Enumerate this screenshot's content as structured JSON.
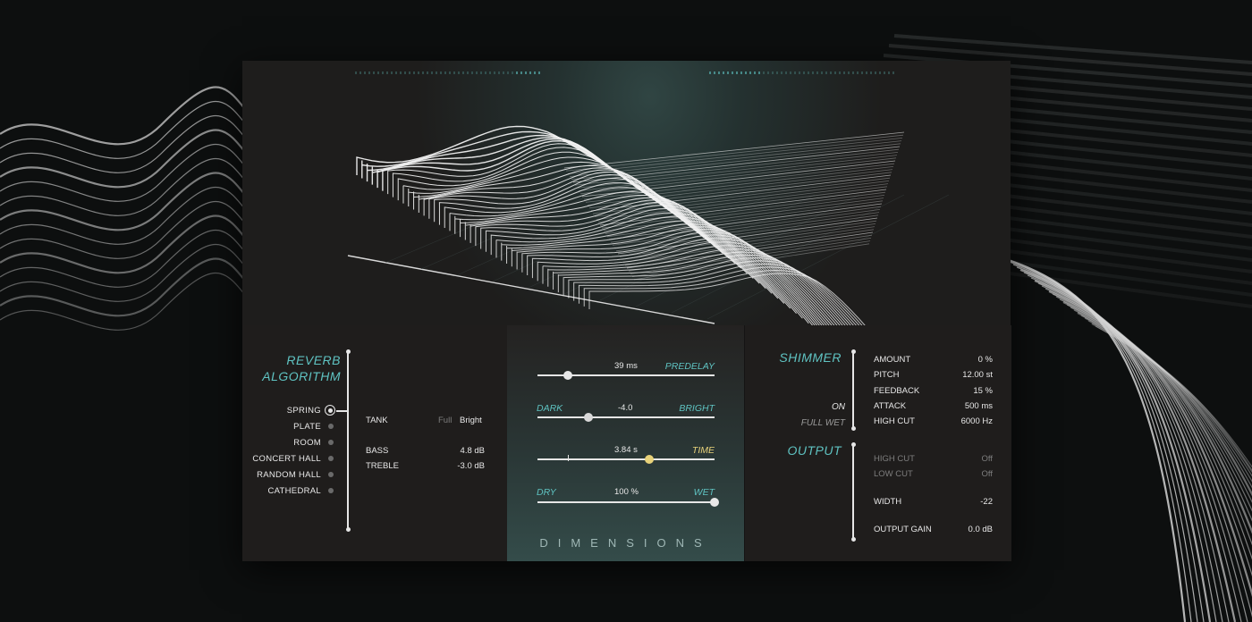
{
  "reverb": {
    "title_line1": "REVERB",
    "title_line2": "ALGORITHM",
    "algorithms": [
      "SPRING",
      "PLATE",
      "ROOM",
      "CONCERT HALL",
      "RANDOM HALL",
      "CATHEDRAL"
    ],
    "selected": "SPRING",
    "tank_label": "TANK",
    "tank_options": [
      "Full",
      "Bright"
    ],
    "tank_selected": "Bright",
    "bass_label": "BASS",
    "bass_value": "4.8 dB",
    "treble_label": "TREBLE",
    "treble_value": "-3.0 dB"
  },
  "center": {
    "predelay_value": "39 ms",
    "predelay_label": "PREDELAY",
    "predelay_level": 0.17,
    "tone_left": "DARK",
    "tone_value": "-4.0",
    "tone_right": "BRIGHT",
    "tone_level": 0.29,
    "time_value": "3.84 s",
    "time_label": "TIME",
    "time_level": 0.63,
    "mix_left": "DRY",
    "mix_value": "100 %",
    "mix_right": "WET",
    "mix_level": 1.0,
    "brand": "DIMENSIONS",
    "time_color": "#e8d27a",
    "accent": "#5fc3c2"
  },
  "shimmer": {
    "title": "SHIMMER",
    "on_label": "ON",
    "fullwet_label": "FULL WET",
    "params": [
      {
        "label": "AMOUNT",
        "value": "0 %"
      },
      {
        "label": "PITCH",
        "value": "12.00 st"
      },
      {
        "label": "FEEDBACK",
        "value": "15 %"
      },
      {
        "label": "ATTACK",
        "value": "500 ms"
      },
      {
        "label": "HIGH CUT",
        "value": "6000 Hz"
      }
    ]
  },
  "output": {
    "title": "OUTPUT",
    "high_cut_label": "HIGH CUT",
    "high_cut_value": "Off",
    "low_cut_label": "LOW CUT",
    "low_cut_value": "Off",
    "width_label": "WIDTH",
    "width_value": "-22",
    "gain_label": "OUTPUT GAIN",
    "gain_value": "0.0 dB"
  }
}
